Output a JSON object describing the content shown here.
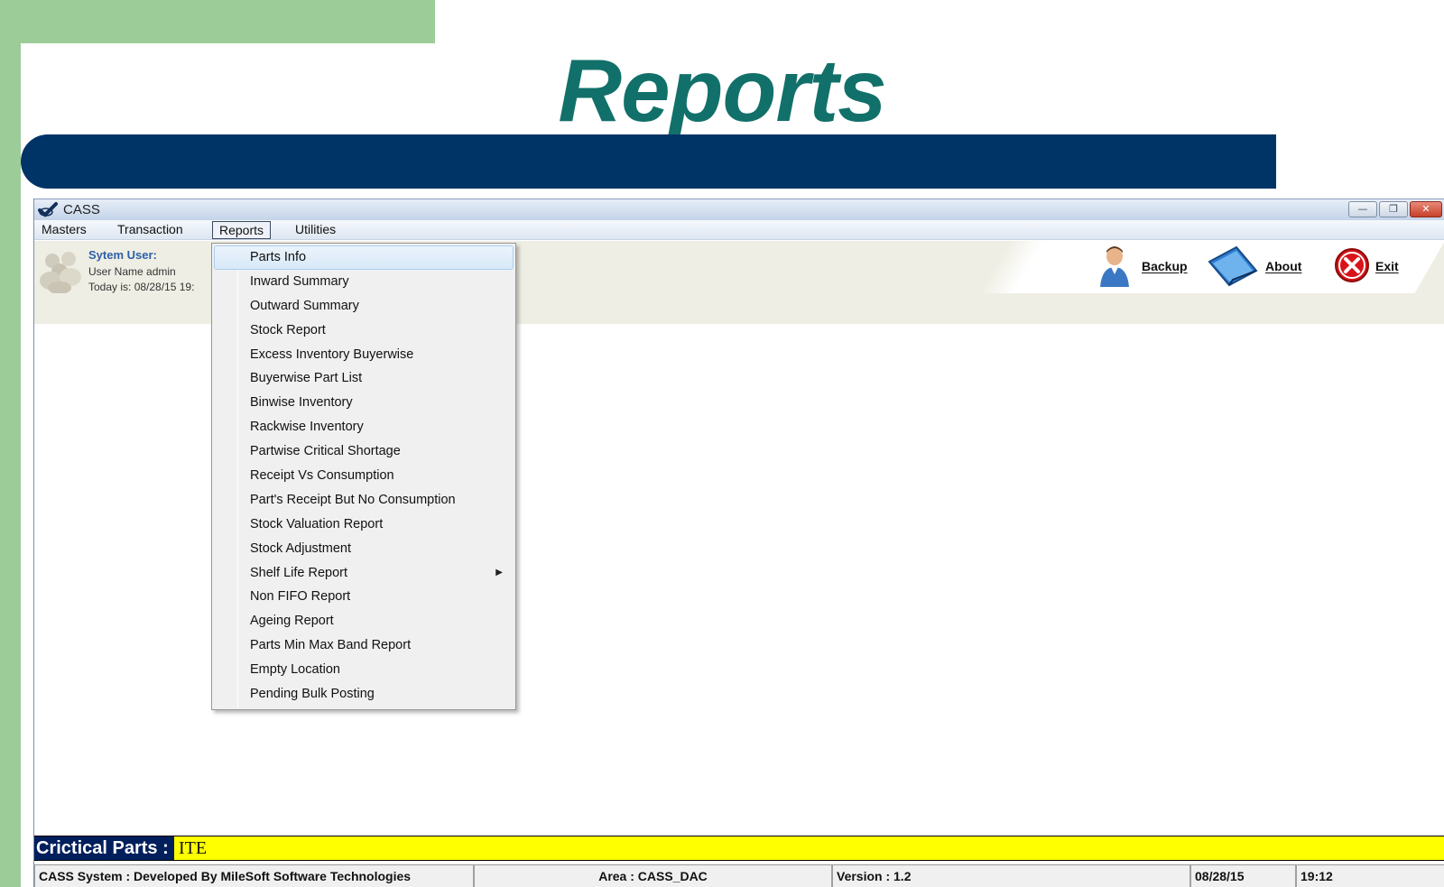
{
  "slide": {
    "title": "Reports"
  },
  "window": {
    "title": "CASS",
    "controls": {
      "minimize": "—",
      "restore": "❐",
      "close": "✕"
    }
  },
  "menubar": {
    "items": [
      {
        "label": "Masters"
      },
      {
        "label": "Transaction"
      },
      {
        "label": "Reports"
      },
      {
        "label": "Utilities"
      }
    ],
    "active": "Reports"
  },
  "user_panel": {
    "heading": "Sytem User:",
    "user_name": "User Name admin",
    "today": "Today is: 08/28/15 19:"
  },
  "toolbar": {
    "backup_label": "Backup",
    "about_label": "About",
    "exit_label": "Exit"
  },
  "reports_menu": {
    "items": [
      {
        "label": "Parts Info",
        "highlighted": true
      },
      {
        "label": "Inward Summary"
      },
      {
        "label": "Outward Summary"
      },
      {
        "label": "Stock Report"
      },
      {
        "label": "Excess Inventory Buyerwise"
      },
      {
        "label": "Buyerwise Part List"
      },
      {
        "label": "Binwise Inventory"
      },
      {
        "label": "Rackwise Inventory"
      },
      {
        "label": "Partwise Critical Shortage"
      },
      {
        "label": "Receipt Vs Consumption"
      },
      {
        "label": "Part's Receipt But No Consumption"
      },
      {
        "label": "Stock Valuation Report"
      },
      {
        "label": "Stock Adjustment"
      },
      {
        "label": "Shelf Life Report",
        "has_submenu": true
      },
      {
        "label": "Non FIFO Report"
      },
      {
        "label": "Ageing Report"
      },
      {
        "label": "Parts Min Max Band Report"
      },
      {
        "label": "Empty Location"
      },
      {
        "label": "Pending Bulk Posting"
      }
    ]
  },
  "critical_parts": {
    "label": "Crictical Parts :",
    "value": "ITE"
  },
  "status_bar": {
    "developer": "CASS System : Developed By MileSoft Software Technologies",
    "area": "Area : CASS_DAC",
    "version": "Version : 1.2",
    "date": "08/28/15",
    "time": "19:12"
  },
  "colors": {
    "slide_green": "#9ccc98",
    "title_teal": "#12706a",
    "band_navy": "#003366",
    "critical_yellow": "#ffff00",
    "critical_label_bg": "#001f5c",
    "user_heading_blue": "#2d5fa6"
  }
}
